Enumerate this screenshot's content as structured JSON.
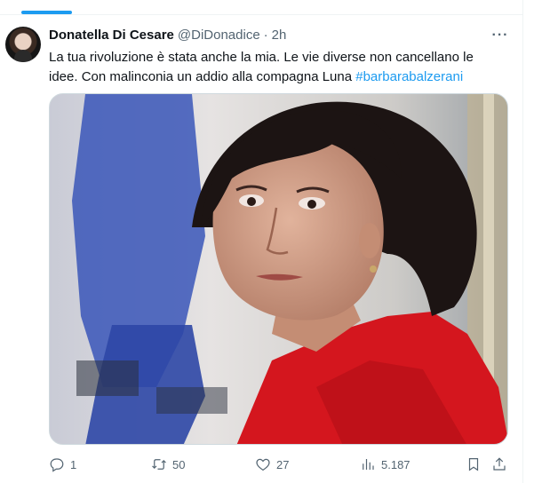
{
  "tweet": {
    "display_name": "Donatella Di Cesare",
    "handle": "@DiDonadice",
    "separator": "·",
    "time": "2h",
    "text_part1": "La tua rivoluzione è stata anche la mia. Le vie diverse non cancellano le idee. Con malinconia un addio alla compagna Luna ",
    "hashtag": "#barbarabalzerani",
    "more_label": "···"
  },
  "actions": {
    "reply_count": "1",
    "retweet_count": "50",
    "like_count": "27",
    "views_count": "5.187"
  },
  "icons": {
    "reply": "reply-icon",
    "retweet": "retweet-icon",
    "like": "heart-icon",
    "views": "views-chart-icon",
    "bookmark": "bookmark-icon",
    "share": "share-icon"
  },
  "colors": {
    "accent": "#1d9bf0",
    "text_primary": "#0f1419",
    "text_secondary": "#536471",
    "border": "#cfd9de"
  }
}
